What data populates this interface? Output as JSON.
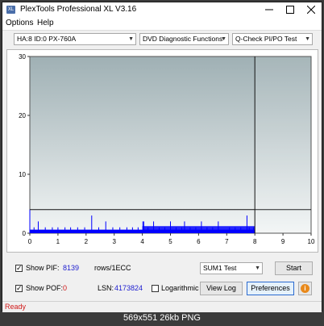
{
  "window": {
    "title": "PlexTools Professional XL V3.16",
    "app_icon_text": "XL",
    "minimize_icon": "minimize-icon",
    "maximize_icon": "maximize-icon",
    "close_icon": "close-icon"
  },
  "menu": {
    "options": "Options",
    "help": "Help"
  },
  "toolbar": {
    "drive": "HA:8 ID:0  PX-760A",
    "function": "DVD Diagnostic Functions",
    "test": "Q-Check PI/PO Test"
  },
  "chart_data": {
    "type": "bar",
    "y_ticks": [
      "30",
      "20",
      "10",
      "0"
    ],
    "x_ticks": [
      "0",
      "1",
      "2",
      "3",
      "4",
      "5",
      "6",
      "7",
      "8",
      "9",
      "10"
    ],
    "xlim": [
      0,
      10
    ],
    "ylim": [
      0,
      30
    ],
    "threshold_line": 4,
    "scan_end": 8,
    "series_color": "#0000ff",
    "background_top": "#9fb0b4",
    "background_bottom": "#f2f5f5",
    "spikes": [
      {
        "x": 0.0,
        "y": 4
      },
      {
        "x": 0.15,
        "y": 1
      },
      {
        "x": 0.3,
        "y": 2
      },
      {
        "x": 0.55,
        "y": 1
      },
      {
        "x": 0.8,
        "y": 1
      },
      {
        "x": 1.0,
        "y": 1
      },
      {
        "x": 1.25,
        "y": 1
      },
      {
        "x": 1.45,
        "y": 1
      },
      {
        "x": 1.7,
        "y": 1
      },
      {
        "x": 1.95,
        "y": 1
      },
      {
        "x": 2.2,
        "y": 3
      },
      {
        "x": 2.45,
        "y": 1
      },
      {
        "x": 2.7,
        "y": 2
      },
      {
        "x": 2.95,
        "y": 1
      },
      {
        "x": 3.2,
        "y": 1
      },
      {
        "x": 3.45,
        "y": 1
      },
      {
        "x": 3.65,
        "y": 1
      },
      {
        "x": 3.85,
        "y": 1
      },
      {
        "x": 4.02,
        "y": 2
      },
      {
        "x": 4.05,
        "y": 2
      },
      {
        "x": 4.2,
        "y": 1
      },
      {
        "x": 4.4,
        "y": 2
      },
      {
        "x": 4.6,
        "y": 1
      },
      {
        "x": 4.8,
        "y": 1
      },
      {
        "x": 5.0,
        "y": 2
      },
      {
        "x": 5.2,
        "y": 1
      },
      {
        "x": 5.4,
        "y": 1
      },
      {
        "x": 5.5,
        "y": 2
      },
      {
        "x": 5.7,
        "y": 1
      },
      {
        "x": 5.9,
        "y": 1
      },
      {
        "x": 6.1,
        "y": 2
      },
      {
        "x": 6.3,
        "y": 1
      },
      {
        "x": 6.5,
        "y": 1
      },
      {
        "x": 6.7,
        "y": 2
      },
      {
        "x": 7.1,
        "y": 1
      },
      {
        "x": 7.3,
        "y": 1
      },
      {
        "x": 7.5,
        "y": 1
      },
      {
        "x": 7.72,
        "y": 3
      },
      {
        "x": 7.8,
        "y": 1
      },
      {
        "x": 7.95,
        "y": 1
      }
    ]
  },
  "bottom": {
    "show_pif_label": "Show PIF:",
    "pif_value": "8139",
    "rows_label": "rows/1ECC",
    "show_pof_label": "Show POF:",
    "pof_value": "0",
    "lsn_label": "LSN:",
    "lsn_value": "4173824",
    "logarithmic_label": "Logarithmic",
    "sum_select": "SUM1 Test",
    "start_button": "Start",
    "viewlog_button": "View Log",
    "preferences_button": "Preferences",
    "info_glyph": "i"
  },
  "status": {
    "text": "Ready"
  },
  "caption": "569x551  26kb  PNG"
}
